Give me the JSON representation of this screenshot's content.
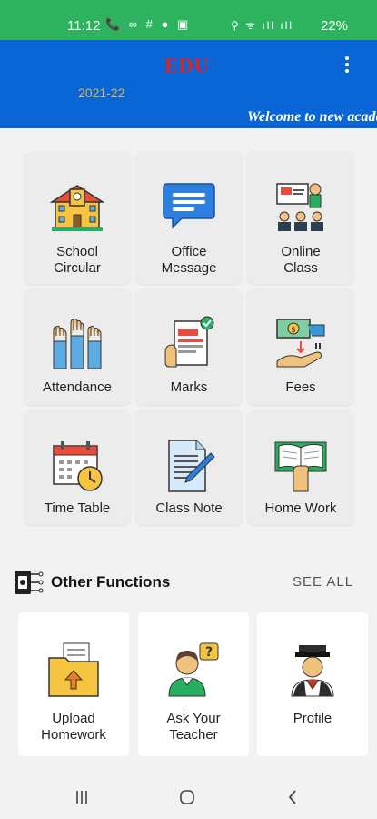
{
  "status_bar": {
    "time": "11:12",
    "left_icons": "📞 ∞ # ● ▣",
    "right_icons": "⚲ ᯤ ıll ıll",
    "battery": "22%"
  },
  "app_bar": {
    "logo_text": "EDU",
    "academic_year": "2021-22",
    "marquee_text": "Welcome to new academic session",
    "menu_icon": "more-vertical-icon"
  },
  "colors": {
    "status_green": "#2db35d",
    "app_blue": "#0a66d6",
    "logo_red": "#e52020"
  },
  "tiles": [
    {
      "label1": "School",
      "label2": "Circular",
      "icon": "school-building-icon"
    },
    {
      "label1": "Office",
      "label2": "Message",
      "icon": "chat-message-icon"
    },
    {
      "label1": "Online",
      "label2": "Class",
      "icon": "online-class-icon"
    },
    {
      "label1": "Attendance",
      "label2": "",
      "icon": "raised-hands-icon"
    },
    {
      "label1": "Marks",
      "label2": "",
      "icon": "marks-report-icon"
    },
    {
      "label1": "Fees",
      "label2": "",
      "icon": "money-hand-icon"
    },
    {
      "label1": "Time Table",
      "label2": "",
      "icon": "calendar-clock-icon"
    },
    {
      "label1": "Class Note",
      "label2": "",
      "icon": "note-pencil-icon"
    },
    {
      "label1": "Home Work",
      "label2": "",
      "icon": "open-book-icon"
    }
  ],
  "other_functions": {
    "title": "Other Functions",
    "see_all": "SEE ALL",
    "items": [
      {
        "label1": "Upload",
        "label2": "Homework",
        "icon": "upload-folder-icon"
      },
      {
        "label1": "Ask Your",
        "label2": "Teacher",
        "icon": "ask-question-icon"
      },
      {
        "label1": "Profile",
        "label2": "",
        "icon": "graduate-avatar-icon"
      }
    ]
  },
  "nav_bar": {
    "recents": "recents-icon",
    "home": "home-icon",
    "back": "back-icon"
  }
}
